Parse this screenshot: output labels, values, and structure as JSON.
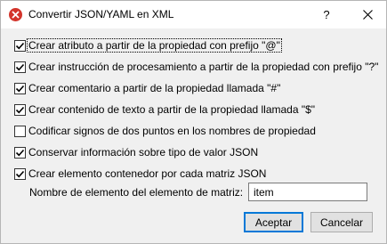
{
  "window": {
    "title": "Convertir JSON/YAML en XML",
    "help_glyph": "?",
    "app_icon": "x-logo-icon",
    "accent_color": "#0078d7"
  },
  "options": [
    {
      "label": "Crear atributo a partir de la propiedad con prefijo \"@\"",
      "checked": true,
      "focused": true
    },
    {
      "label": "Crear instrucción de procesamiento a partir de la propiedad con prefijo \"?\"",
      "checked": true
    },
    {
      "label": "Crear comentario a partir de la propiedad llamada \"#\"",
      "checked": true
    },
    {
      "label": "Crear contenido de texto a partir de la propiedad llamada \"$\"",
      "checked": true
    },
    {
      "label": "Codificar signos de dos puntos en los nombres de propiedad",
      "checked": false
    },
    {
      "label": "Conservar información sobre tipo de valor JSON",
      "checked": true
    },
    {
      "label": "Crear elemento contenedor por cada matriz JSON",
      "checked": true
    }
  ],
  "array_element": {
    "label": "Nombre de elemento del elemento de matriz:",
    "value": "item"
  },
  "buttons": {
    "accept": "Aceptar",
    "cancel": "Cancelar"
  }
}
